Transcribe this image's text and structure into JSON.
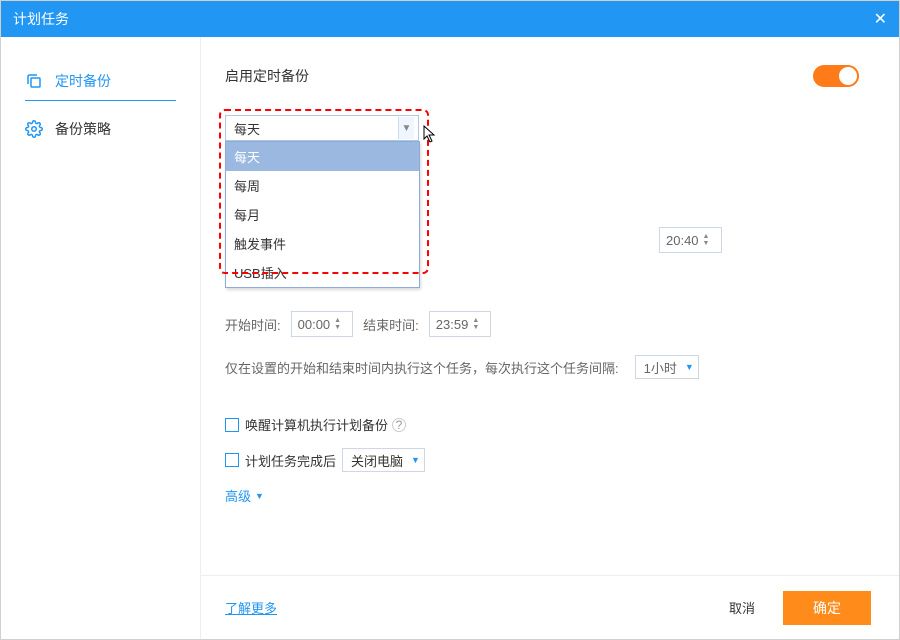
{
  "window": {
    "title": "计划任务"
  },
  "sidebar": {
    "items": [
      {
        "label": "定时备份"
      },
      {
        "label": "备份策略"
      }
    ]
  },
  "main": {
    "enable_label": "启用定时备份",
    "freq_select": {
      "value": "每天"
    },
    "freq_options": [
      "每天",
      "每周",
      "每月",
      "触发事件",
      "USB插入"
    ],
    "time_value": "20:40",
    "start_label": "开始时间:",
    "start_value": "00:00",
    "end_label": "结束时间:",
    "end_value": "23:59",
    "interval_text": "仅在设置的开始和结束时间内执行这个任务，每次执行这个任务间隔:",
    "interval_value": "1小时",
    "wake_label": "唤醒计算机执行计划备份",
    "after_label": "计划任务完成后",
    "after_value": "关闭电脑",
    "advanced": "高级"
  },
  "footer": {
    "learn_more": "了解更多",
    "cancel": "取消",
    "confirm": "确定"
  }
}
